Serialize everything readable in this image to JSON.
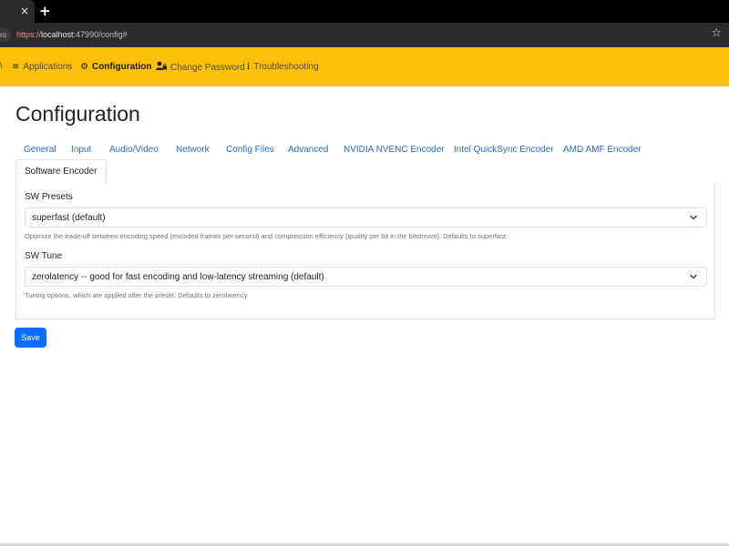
{
  "browser": {
    "tab_close_glyph": "×",
    "new_tab_glyph": "+",
    "chip_text": "ro",
    "url_scheme": "https://",
    "url_host": "localhost",
    "url_rest": ":47990/config#",
    "bookmark_icon": "star-icon"
  },
  "navbar": {
    "color": "#ffc107",
    "edge_text": "\\",
    "items": [
      {
        "label": "Applications",
        "icon": "list-icon"
      },
      {
        "label": "Configuration",
        "icon": "gear-icon"
      },
      {
        "label": "Change Password",
        "icon": "user-lock-icon"
      },
      {
        "label": "Troubleshooting",
        "icon": "info-icon"
      }
    ]
  },
  "page": {
    "title": "Configuration"
  },
  "tabs": [
    "General",
    "Input",
    "Audio/Video",
    "Network",
    "Config Files",
    "Advanced",
    "NVIDIA NVENC Encoder",
    "Intel QuickSync Encoder",
    "AMD AMF Encoder",
    "Software Encoder"
  ],
  "active_tab": "Software Encoder",
  "fields": {
    "sw_presets": {
      "label": "SW Presets",
      "value": "superfast (default)",
      "help": "Optimize the trade-off between encoding speed (encoded frames per second) and compression efficiency (quality per bit in the bitstream). Defaults to superfast."
    },
    "sw_tune": {
      "label": "SW Tune",
      "value": "zerolatency -- good for fast encoding and low-latency streaming (default)",
      "help": "Tuning options, which are applied after the preset. Defaults to zerolatency."
    }
  },
  "actions": {
    "save_label": "Save",
    "save_color": "#0d6efd"
  }
}
